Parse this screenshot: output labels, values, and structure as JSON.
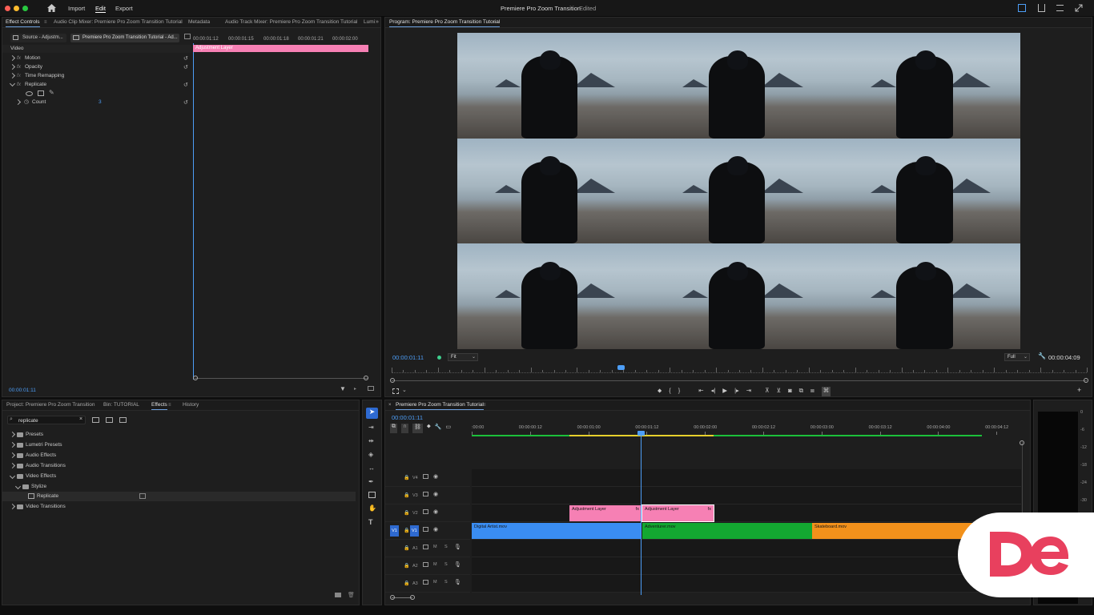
{
  "app": {
    "workspaces": [
      "Import",
      "Edit",
      "Export"
    ],
    "active_workspace": "Edit",
    "title": "Premiere Pro Zoom Transition",
    "title_status": "Edited"
  },
  "effect_controls": {
    "tabs": [
      "Effect Controls",
      "Audio Clip Mixer: Premiere Pro Zoom Transition Tutorial",
      "Metadata",
      "Audio Track Mixer: Premiere Pro Zoom Transition Tutorial",
      "Lumi"
    ],
    "source_label": "Source - Adjustm...",
    "sequence_label": "Premiere Pro Zoom Transition Tutorial - Ad...",
    "ruler_times": [
      "00:00:01:12",
      "00:00:01:15",
      "00:00:01:18",
      "00:00:01:21",
      "00:00:02:00"
    ],
    "clip_name": "Adjustment Layer",
    "section": "Video",
    "effects": [
      {
        "name": "Motion",
        "fx": "fx"
      },
      {
        "name": "Opacity",
        "fx": "fx"
      },
      {
        "name": "Time Remapping",
        "fx": "fx"
      },
      {
        "name": "Replicate",
        "fx": "fx"
      }
    ],
    "param_name": "Count",
    "param_value": "3",
    "timecode": "00:00:01:11"
  },
  "program": {
    "tab": "Program: Premiere Pro Zoom Transition Tutorial",
    "timecode": "00:00:01:11",
    "zoom": "Fit",
    "resolution": "Full",
    "duration": "00:00:04:09",
    "playhead_fraction": 0.33,
    "grid": 3
  },
  "project": {
    "tabs": [
      "Project: Premiere Pro Zoom Transition",
      "Bin: TUTORIAL",
      "Effects",
      "History"
    ],
    "search_value": "replicate",
    "tree": [
      {
        "label": "Presets",
        "level": 0,
        "open": false
      },
      {
        "label": "Lumetri Presets",
        "level": 0,
        "open": false
      },
      {
        "label": "Audio Effects",
        "level": 0,
        "open": false
      },
      {
        "label": "Audio Transitions",
        "level": 0,
        "open": false
      },
      {
        "label": "Video Effects",
        "level": 0,
        "open": true
      },
      {
        "label": "Stylize",
        "level": 1,
        "open": true
      },
      {
        "label": "Replicate",
        "level": 2,
        "open": false
      },
      {
        "label": "Video Transitions",
        "level": 0,
        "open": false
      }
    ]
  },
  "timeline": {
    "tab": "Premiere Pro Zoom Transition Tutorial",
    "timecode": "00:00:01:11",
    "ruler": [
      ":00:00",
      "00:00:00:12",
      "00:00:01:00",
      "00:00:01:12",
      "00:00:02:00",
      "00:00:02:12",
      "00:00:03:00",
      "00:00:03:12",
      "00:00:04:00",
      "00:00:04:12"
    ],
    "tracks": [
      "V4",
      "V3",
      "V2",
      "V1",
      "A1",
      "A2",
      "A3"
    ],
    "source_patch": "V1",
    "audio_controls": [
      "M",
      "S"
    ],
    "clips_v2": [
      {
        "name": "Adjustment Layer",
        "fx": "fx"
      },
      {
        "name": "Adjustment Layer",
        "fx": "fx"
      }
    ],
    "clips_v1": [
      {
        "name": "Digital Artist.mov",
        "color": "#3a8df2"
      },
      {
        "name": "Adventurer.mov",
        "color": "#13a831"
      },
      {
        "name": "Skateboard.mov",
        "color": "#f2911b"
      }
    ]
  },
  "meter": {
    "scale": [
      "0",
      "-6",
      "-12",
      "-18",
      "-24",
      "-30"
    ]
  },
  "colors": {
    "accent": "#4d9ef7",
    "adjustment": "#f680b4",
    "logo_red": "#e8405e"
  }
}
